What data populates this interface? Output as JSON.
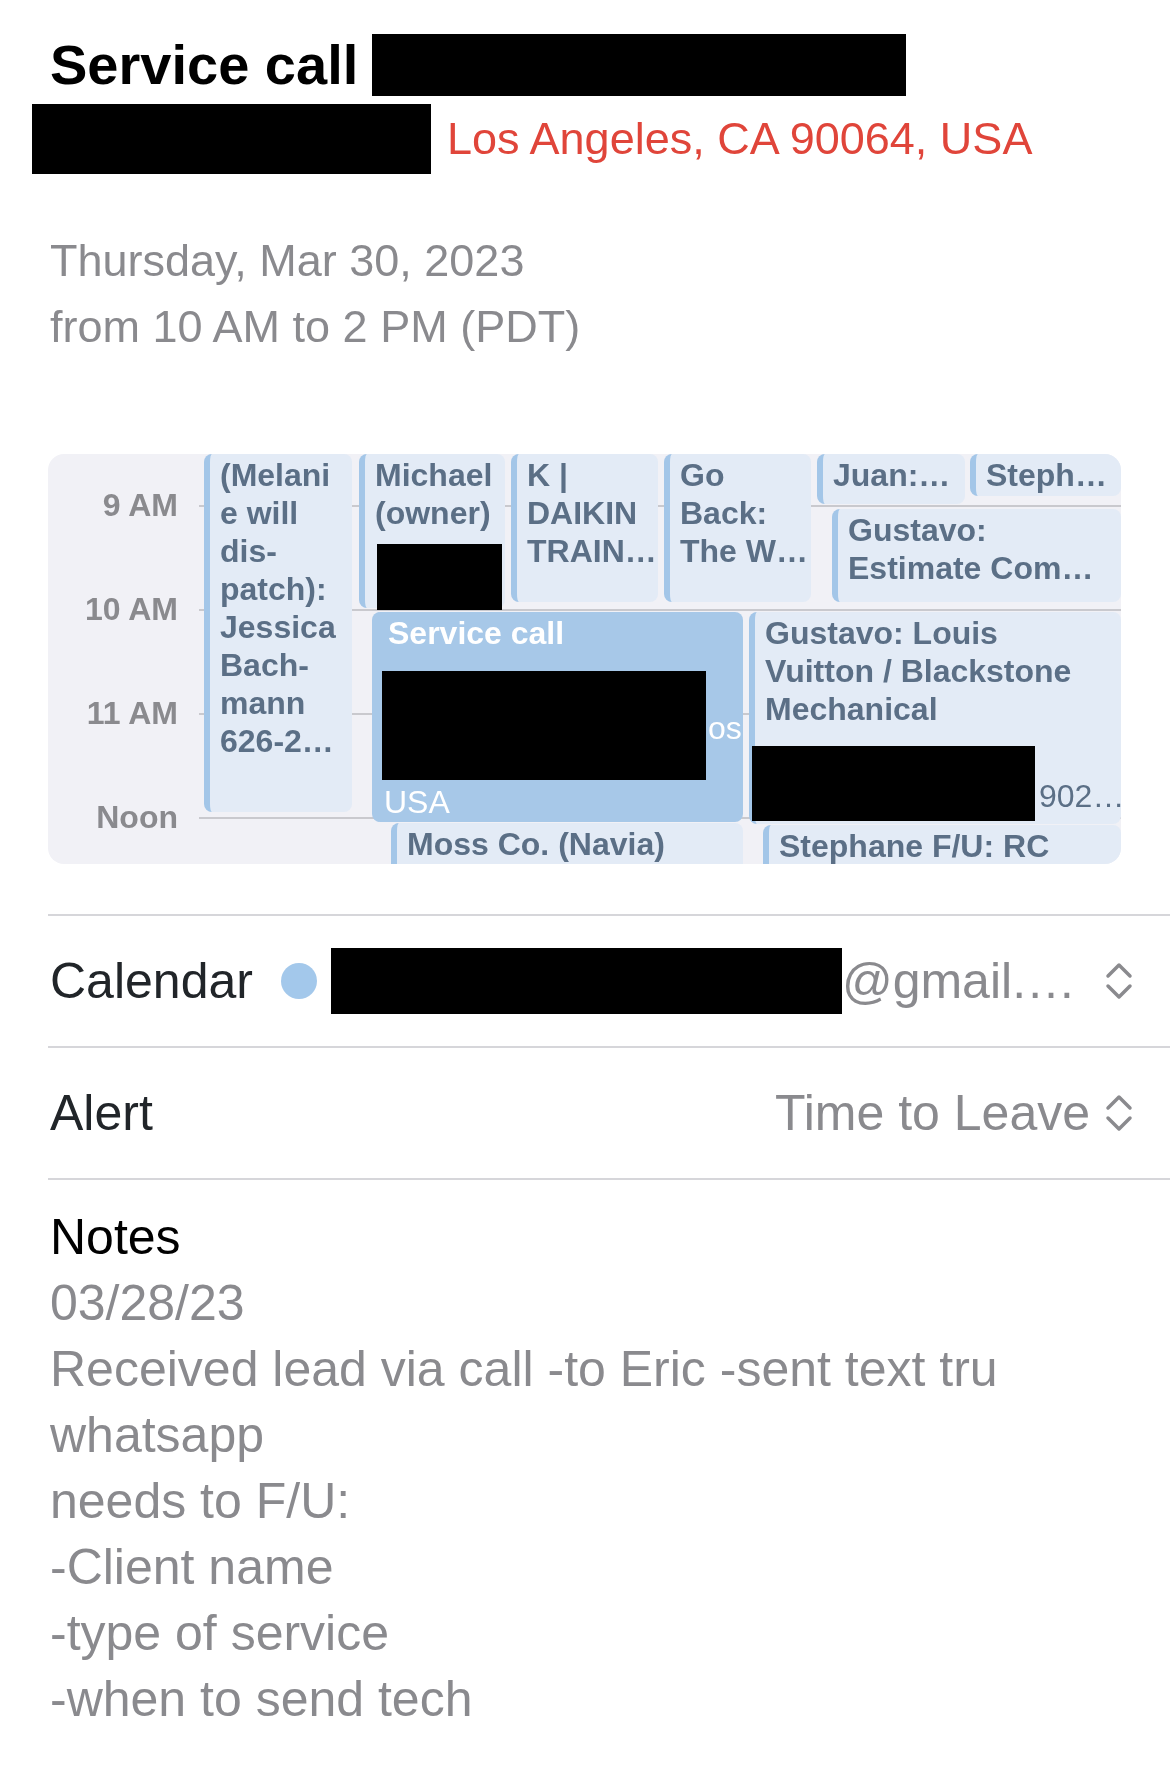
{
  "event": {
    "title": "Service call",
    "address": "Los Angeles, CA 90064, USA",
    "date": "Thursday, Mar 30, 2023",
    "time": "from 10 AM to 2 PM (PDT)"
  },
  "day_view": {
    "hours": [
      "9 AM",
      "10 AM",
      "11 AM",
      "Noon"
    ],
    "events": [
      {
        "lines": [
          "(Melani",
          "e will",
          "dis-",
          "patch):",
          "Jessica",
          "Bach-",
          "mann",
          "626-2…"
        ],
        "selected": false
      },
      {
        "lines": [
          "Michael",
          "(owner)"
        ],
        "selected": false
      },
      {
        "lines": [
          "K |",
          "DAIKIN",
          "TRAIN…"
        ],
        "selected": false
      },
      {
        "lines": [
          "Go",
          "Back:",
          "The W…"
        ],
        "selected": false
      },
      {
        "lines": [
          "Juan:…"
        ],
        "selected": false
      },
      {
        "lines": [
          "Steph…"
        ],
        "selected": false
      },
      {
        "lines": [
          "Gustavo:",
          "Estimate Com…"
        ],
        "selected": false
      },
      {
        "lines": [
          "Service call"
        ],
        "fragments": [
          "os",
          "USA"
        ],
        "selected": true
      },
      {
        "lines": [
          "Gustavo: Louis",
          "Vuitton / Blackstone",
          "Mechanical"
        ],
        "fragments": [
          "902…"
        ],
        "selected": false
      },
      {
        "lines": [
          "Moss Co. (Navia)"
        ],
        "selected": false
      },
      {
        "lines": [
          "Stephane F/U: RC"
        ],
        "selected": false
      }
    ]
  },
  "calendar": {
    "label": "Calendar",
    "color": "#a3c8eb",
    "account": "@gmail.…"
  },
  "alert": {
    "label": "Alert",
    "value": "Time to Leave"
  },
  "notes": {
    "label": "Notes",
    "lines": [
      "03/28/23",
      "Received lead via call -to Eric -sent text tru",
      "whatsapp",
      "needs to F/U:",
      "-Client name",
      "-type of service",
      "-when to send tech"
    ]
  }
}
